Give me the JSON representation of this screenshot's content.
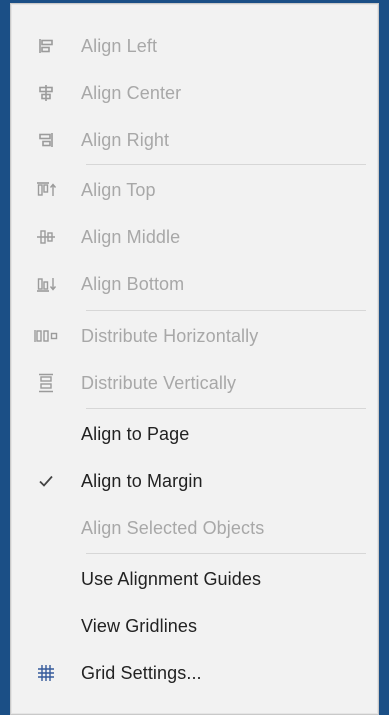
{
  "menu": {
    "items": [
      {
        "icon": "align-left-icon",
        "label": "Align Left",
        "disabled": true
      },
      {
        "icon": "align-center-icon",
        "label": "Align Center",
        "disabled": true
      },
      {
        "icon": "align-right-icon",
        "label": "Align Right",
        "disabled": true
      },
      {
        "icon": "align-top-icon",
        "label": "Align Top",
        "disabled": true
      },
      {
        "icon": "align-middle-icon",
        "label": "Align Middle",
        "disabled": true
      },
      {
        "icon": "align-bottom-icon",
        "label": "Align Bottom",
        "disabled": true
      },
      {
        "icon": "distribute-horizontally-icon",
        "label": "Distribute Horizontally",
        "disabled": true
      },
      {
        "icon": "distribute-vertically-icon",
        "label": "Distribute Vertically",
        "disabled": true
      },
      {
        "icon": "",
        "label": "Align to Page",
        "disabled": false
      },
      {
        "icon": "checkmark-icon",
        "label": "Align to Margin",
        "disabled": false,
        "checked": true
      },
      {
        "icon": "",
        "label": "Align Selected Objects",
        "disabled": true
      },
      {
        "icon": "",
        "label": "Use Alignment Guides",
        "disabled": false
      },
      {
        "icon": "",
        "label": "View Gridlines",
        "disabled": false
      },
      {
        "icon": "grid-settings-icon",
        "label": "Grid Settings...",
        "disabled": false
      }
    ]
  },
  "colors": {
    "background": "#1b4f86",
    "menu_bg": "#f2f2f2",
    "text": "#222222",
    "disabled_text": "#a8a8a8",
    "separator": "#d7d7d7",
    "icon_grid": "#355a9b"
  }
}
